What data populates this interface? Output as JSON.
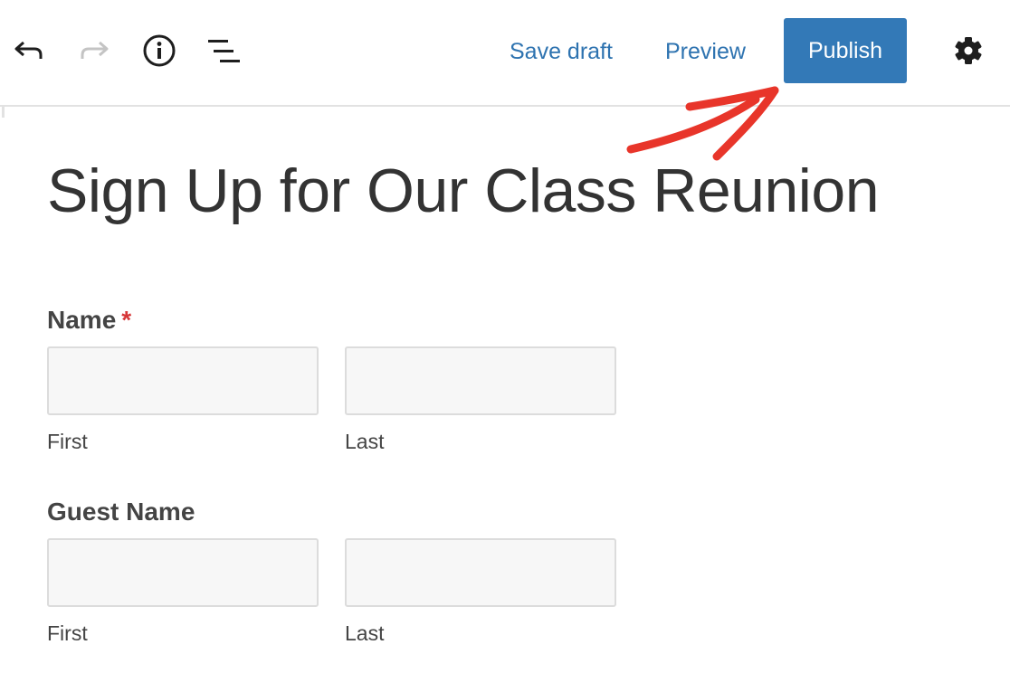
{
  "toolbar": {
    "undo_icon": "undo-arrow",
    "redo_icon": "redo-arrow",
    "info_icon": "info-circle",
    "outline_icon": "list-outline",
    "save_draft_label": "Save draft",
    "preview_label": "Preview",
    "publish_label": "Publish",
    "settings_icon": "gear",
    "publish_color": "#3379b7",
    "link_color": "#2e73b0"
  },
  "page": {
    "title": "Sign Up for Our Class Reunion"
  },
  "form": {
    "fields": [
      {
        "label": "Name",
        "required_mark": "*",
        "sub_fields": [
          {
            "sublabel": "First",
            "value": ""
          },
          {
            "sublabel": "Last",
            "value": ""
          }
        ]
      },
      {
        "label": "Guest Name",
        "required_mark": "",
        "sub_fields": [
          {
            "sublabel": "First",
            "value": ""
          },
          {
            "sublabel": "Last",
            "value": ""
          }
        ]
      }
    ]
  },
  "annotation": {
    "type": "arrow",
    "color": "#e8352a",
    "points_to": "Publish"
  }
}
